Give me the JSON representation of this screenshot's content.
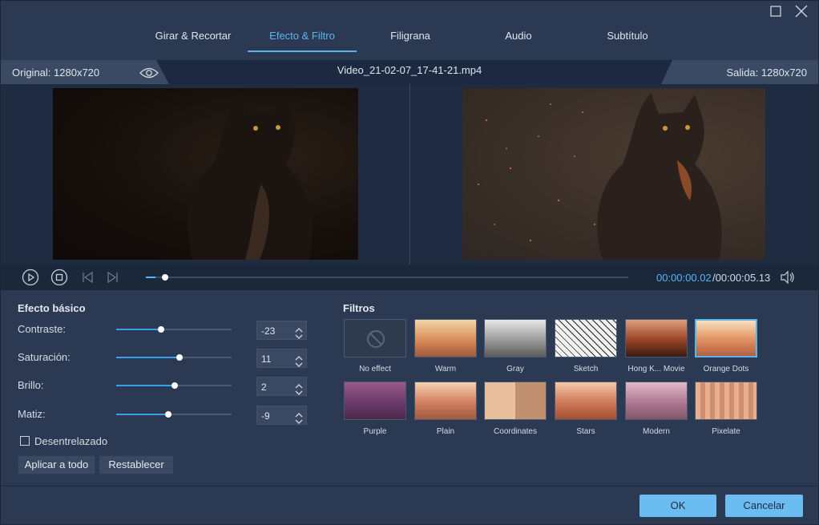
{
  "window": {
    "maximize_icon": "maximize-icon",
    "close_icon": "close-icon"
  },
  "tabs": [
    {
      "label": "Girar & Recortar",
      "active": false
    },
    {
      "label": "Efecto & Filtro",
      "active": true
    },
    {
      "label": "Filigrana",
      "active": false
    },
    {
      "label": "Audio",
      "active": false
    },
    {
      "label": "Subtítulo",
      "active": false
    }
  ],
  "infobar": {
    "original": "Original: 1280x720",
    "filename": "Video_21-02-07_17-41-21.mp4",
    "output": "Salida: 1280x720"
  },
  "playback": {
    "current_time": "00:00:00.02",
    "total_time": "/00:00:05.13",
    "progress": 0.02
  },
  "basic_effects": {
    "title": "Efecto básico",
    "items": [
      {
        "label": "Contraste:",
        "value": "-23",
        "level": 0.39
      },
      {
        "label": "Saturación:",
        "value": "11",
        "level": 0.55
      },
      {
        "label": "Brillo:",
        "value": "2",
        "level": 0.51
      },
      {
        "label": "Matiz:",
        "value": "-9",
        "level": 0.45
      }
    ],
    "deinterlace_label": "Desentrelazado",
    "deinterlace_checked": false,
    "apply_all": "Aplicar a todo",
    "reset": "Restablecer"
  },
  "filters": {
    "title": "Filtros",
    "items": [
      {
        "name": "No effect",
        "selected": false
      },
      {
        "name": "Warm",
        "selected": false
      },
      {
        "name": "Gray",
        "selected": false
      },
      {
        "name": "Sketch",
        "selected": false
      },
      {
        "name": "Hong K... Movie",
        "selected": false
      },
      {
        "name": "Orange Dots",
        "selected": true
      },
      {
        "name": "Purple",
        "selected": false
      },
      {
        "name": "Plain",
        "selected": false
      },
      {
        "name": "Coordinates",
        "selected": false
      },
      {
        "name": "Stars",
        "selected": false
      },
      {
        "name": "Modern",
        "selected": false
      },
      {
        "name": "Pixelate",
        "selected": false
      }
    ]
  },
  "footer": {
    "ok": "OK",
    "cancel": "Cancelar"
  },
  "colors": {
    "accent": "#5ab4f0",
    "button_blue": "#6bbcf0",
    "background": "#2b3a52"
  }
}
